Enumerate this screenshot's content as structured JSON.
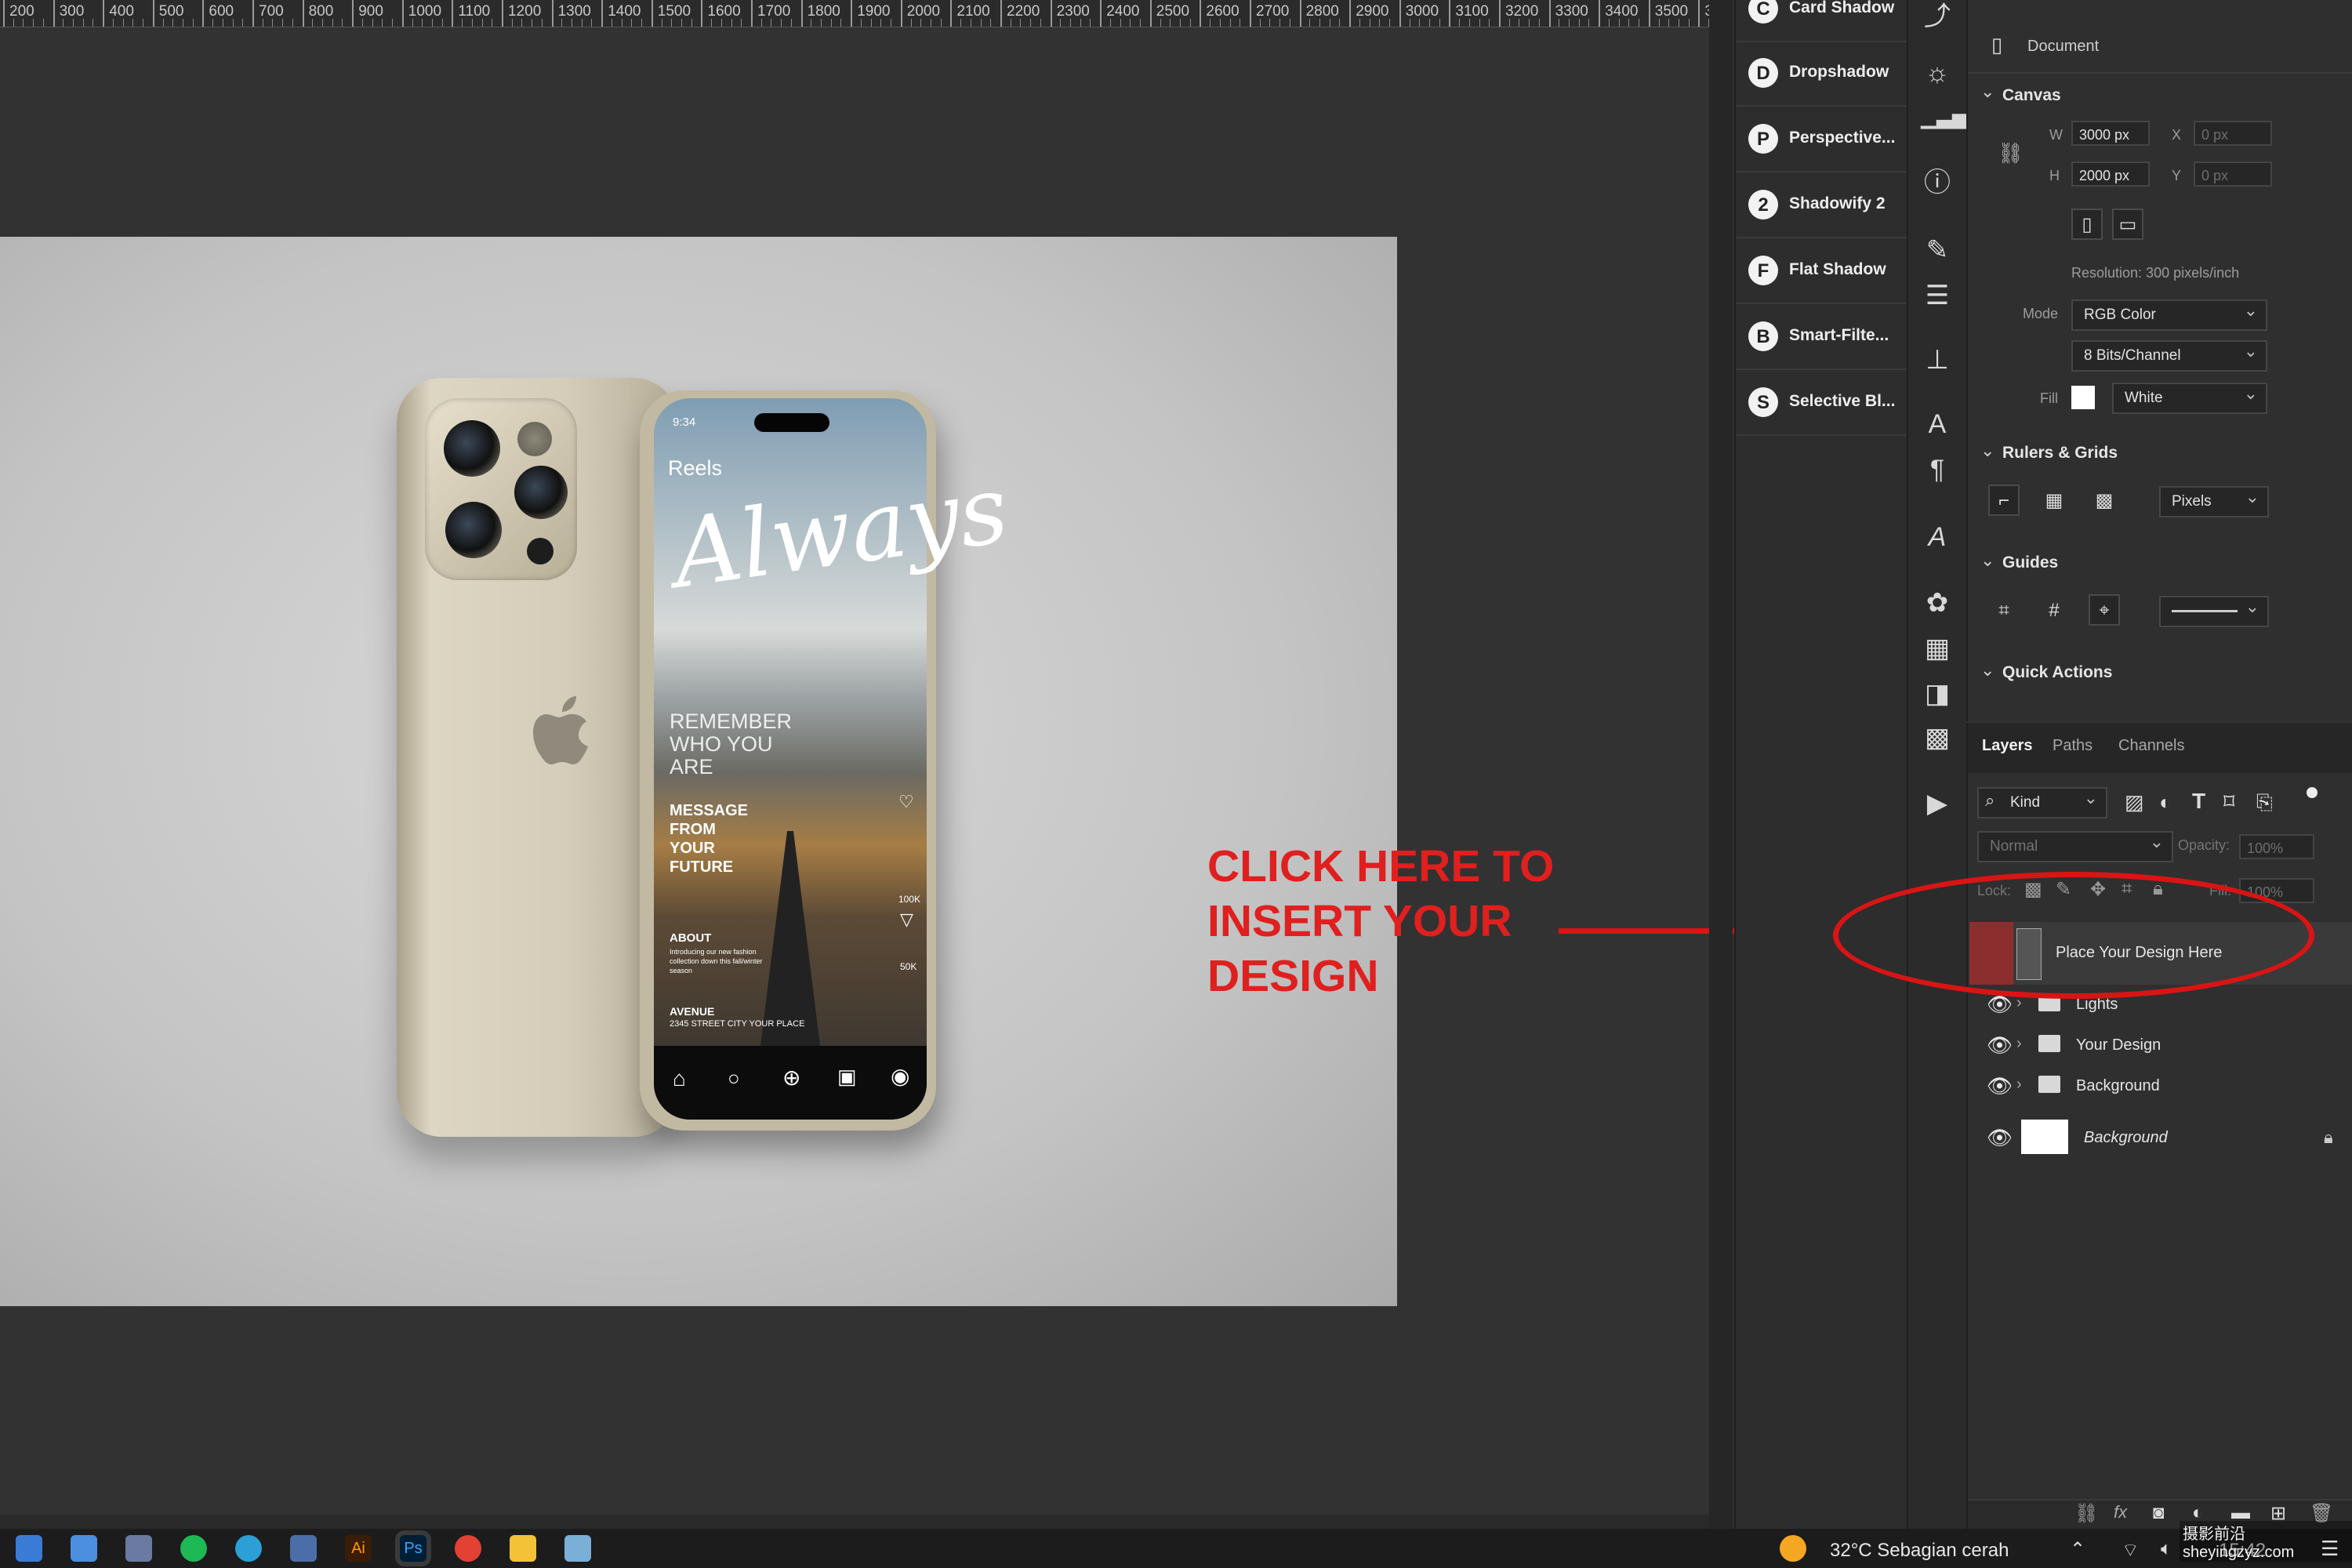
{
  "ruler": {
    "ticks": [
      "200",
      "300",
      "400",
      "500",
      "600",
      "700",
      "800",
      "900",
      "1000",
      "1100",
      "1200",
      "1300",
      "1400",
      "1500",
      "1600",
      "1700",
      "1800",
      "1900",
      "2000",
      "2100",
      "2200",
      "2300",
      "2400",
      "2500",
      "2600",
      "2700",
      "2800",
      "2900",
      "3000",
      "3100",
      "3200",
      "3300",
      "3400",
      "3500",
      "3"
    ]
  },
  "mockup": {
    "screen_title": "Reels",
    "script_word": "Always",
    "lines": [
      "REMEMBER",
      "WHO YOU",
      "ARE"
    ],
    "message": [
      "MESSAGE",
      "FROM",
      "YOUR",
      "FUTURE"
    ],
    "about_title": "ABOUT",
    "about_text": "Introducing our new fashion collection down this fall/winter season",
    "avenue_title": "AVENUE",
    "avenue_text": "2345 STREET CITY YOUR PLACE",
    "stat1": "100K",
    "stat2": "50K",
    "time": "9:34"
  },
  "annotation": {
    "lines": [
      "CLICK HERE TO",
      "INSERT YOUR",
      "DESIGN"
    ],
    "color": "#e01f1f"
  },
  "plugins": [
    {
      "icon": "card-shadow-icon",
      "glyph": "C",
      "label": "Card Shadow"
    },
    {
      "icon": "dropshadow-icon",
      "glyph": "D",
      "label": "Dropshadow"
    },
    {
      "icon": "perspective-icon",
      "glyph": "P",
      "label": "Perspective..."
    },
    {
      "icon": "shadowify-icon",
      "glyph": "2",
      "label": "Shadowify 2"
    },
    {
      "icon": "flat-shadow-icon",
      "glyph": "F",
      "label": "Flat Shadow"
    },
    {
      "icon": "smart-filter-icon",
      "glyph": "B",
      "label": "Smart-Filte..."
    },
    {
      "icon": "selective-blur-icon",
      "glyph": "S",
      "label": "Selective Bl..."
    }
  ],
  "properties": {
    "document_label": "Document",
    "canvas_title": "Canvas",
    "w_label": "W",
    "w_value": "3000 px",
    "h_label": "H",
    "h_value": "2000 px",
    "x_label": "X",
    "x_value": "0 px",
    "y_label": "Y",
    "y_value": "0 px",
    "resolution": "Resolution: 300 pixels/inch",
    "mode_label": "Mode",
    "mode_value": "RGB Color",
    "bits_value": "8 Bits/Channel",
    "fill_label": "Fill",
    "fill_value": "White",
    "rulers_title": "Rulers & Grids",
    "units_value": "Pixels",
    "guides_title": "Guides",
    "quick_actions_title": "Quick Actions"
  },
  "layers_panel": {
    "tabs": [
      "Layers",
      "Paths",
      "Channels"
    ],
    "kind_label": "Kind",
    "blend_value": "Normal",
    "opacity_label": "Opacity:",
    "opacity_value": "100%",
    "lock_label": "Lock:",
    "fill_label": "Fill:",
    "fill_value": "100%",
    "layers": [
      {
        "name": "Place Your Design Here",
        "type": "smart-object",
        "selected": true
      },
      {
        "name": "Lights",
        "type": "group"
      },
      {
        "name": "Your Design",
        "type": "group"
      },
      {
        "name": "Background",
        "type": "group"
      },
      {
        "name": "Background",
        "type": "background",
        "italic": true
      }
    ]
  },
  "taskbar": {
    "weather": "32°C  Sebagian cerah",
    "time": "15:42",
    "watermark": "摄影前沿 sheyingzyz.com"
  }
}
